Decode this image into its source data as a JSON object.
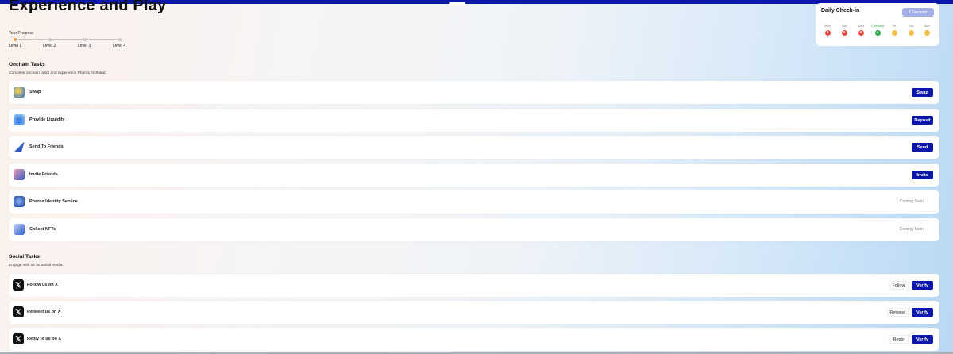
{
  "page": {
    "title": "Experience and Play"
  },
  "progress": {
    "label": "Your Progress",
    "levels": [
      "Level 1",
      "Level 2",
      "Level 3",
      "Level 4"
    ],
    "current_level": 1
  },
  "checkin": {
    "title": "Daily Check-in",
    "button": "Checked",
    "days": [
      {
        "name": "Mon",
        "status": "missed",
        "icon": "x-icon"
      },
      {
        "name": "Tue",
        "status": "missed",
        "icon": "x-icon"
      },
      {
        "name": "Wed",
        "status": "missed",
        "icon": "x-icon"
      },
      {
        "name": "Checked",
        "status": "done",
        "icon": "check-icon"
      },
      {
        "name": "Fri",
        "status": "future",
        "icon": "coin-icon"
      },
      {
        "name": "Sat",
        "status": "future",
        "icon": "coin-icon"
      },
      {
        "name": "Sun",
        "status": "future",
        "icon": "coin-icon"
      }
    ]
  },
  "onchain": {
    "title": "Onchain Tasks",
    "subtitle": "Complete onchain tasks and experience Pharos firsthand.",
    "tasks": [
      {
        "label": "Swap",
        "action": "Swap",
        "icon": "swap-icon"
      },
      {
        "label": "Provide Liquidity",
        "action": "Deposit",
        "icon": "liquidity-icon"
      },
      {
        "label": "Send To Friends",
        "action": "Send",
        "icon": "send-icon"
      },
      {
        "label": "Invite Friends",
        "action": "Invite",
        "icon": "invite-icon"
      },
      {
        "label": "Pharos Identity Service",
        "status": "Coming Soon",
        "icon": "identity-icon"
      },
      {
        "label": "Collect NFTs",
        "status": "Coming Soon",
        "icon": "nft-icon"
      }
    ]
  },
  "social": {
    "title": "Social Tasks",
    "subtitle": "Engage with us on social media.",
    "tasks": [
      {
        "label": "Follow us on X",
        "action": "Follow",
        "verify": "Verify",
        "icon": "x-logo-icon"
      },
      {
        "label": "Retweet us on X",
        "action": "Retweet",
        "verify": "Verify",
        "icon": "x-logo-icon"
      },
      {
        "label": "Reply to us on X",
        "action": "Reply",
        "verify": "Verify",
        "icon": "x-logo-icon"
      }
    ]
  },
  "colors": {
    "primary": "#0a17a8",
    "checked_button": "#a6b0e8",
    "active_level": "#e59a3d"
  }
}
